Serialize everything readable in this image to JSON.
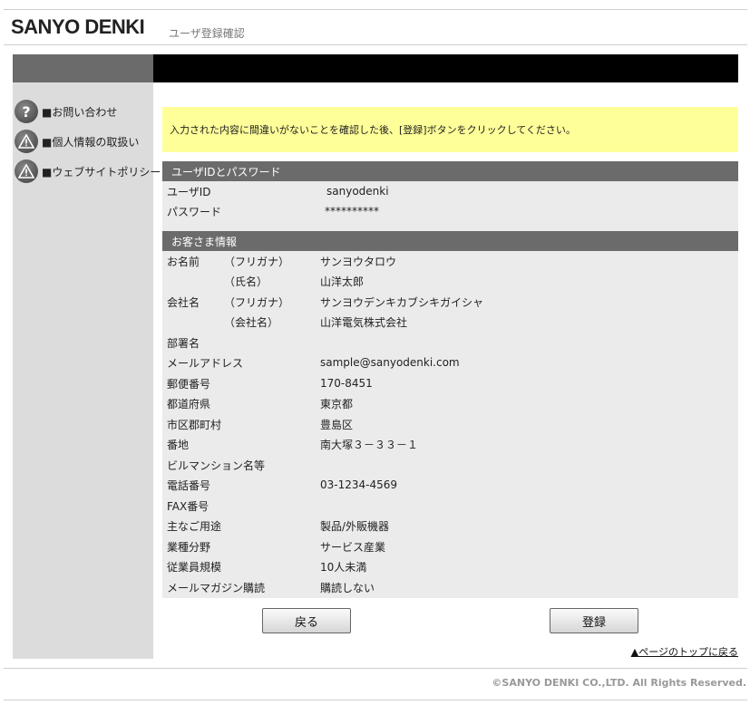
{
  "header": {
    "logo": "SANYO DENKI",
    "title": "ユーザ登録確認"
  },
  "sidebar": {
    "items": [
      {
        "label": "■お問い合わせ",
        "icon": "question-icon"
      },
      {
        "label": "■個人情報の取扱い",
        "icon": "warning-icon"
      },
      {
        "label": "■ウェブサイトポリシー",
        "icon": "warning-icon"
      }
    ]
  },
  "notice": "入力された内容に間違いがないことを確認した後、[登録]ボタンをクリックしてください。",
  "account": {
    "heading": "ユーザIDとパスワード",
    "user_id_label": "ユーザID",
    "user_id_value": "sanyodenki",
    "password_label": "パスワード",
    "password_value": "**********"
  },
  "customer": {
    "heading": "お客さま情報",
    "name_label": "お名前",
    "name_kana_sub": "（フリガナ）",
    "name_kana_value": "サンヨウタロウ",
    "name_sub": "（氏名）",
    "name_value": "山洋太郎",
    "company_label": "会社名",
    "company_kana_sub": "（フリガナ）",
    "company_kana_value": "サンヨウデンキカブシキガイシャ",
    "company_sub": "（会社名）",
    "company_value": "山洋電気株式会社",
    "fields": [
      {
        "label": "部署名",
        "value": ""
      },
      {
        "label": "メールアドレス",
        "value": "sample@sanyodenki.com"
      },
      {
        "label": "郵便番号",
        "value": "170-8451"
      },
      {
        "label": "都道府県",
        "value": "東京都"
      },
      {
        "label": "市区郡町村",
        "value": "豊島区"
      },
      {
        "label": "番地",
        "value": "南大塚３－３３－１"
      },
      {
        "label": "ビルマンション名等",
        "value": ""
      },
      {
        "label": "電話番号",
        "value": "03-1234-4569"
      },
      {
        "label": "FAX番号",
        "value": ""
      },
      {
        "label": "主なご用途",
        "value": "製品/外販機器"
      },
      {
        "label": "業種分野",
        "value": "サービス産業"
      },
      {
        "label": "従業員規模",
        "value": "10人未満"
      },
      {
        "label": "メールマガジン購読",
        "value": "購読しない"
      }
    ]
  },
  "buttons": {
    "back": "戻る",
    "register": "登録"
  },
  "page_top_link": "▲ページのトップに戻る",
  "footer": {
    "copyright": "©SANYO DENKI CO.,LTD. All Rights Reserved."
  }
}
